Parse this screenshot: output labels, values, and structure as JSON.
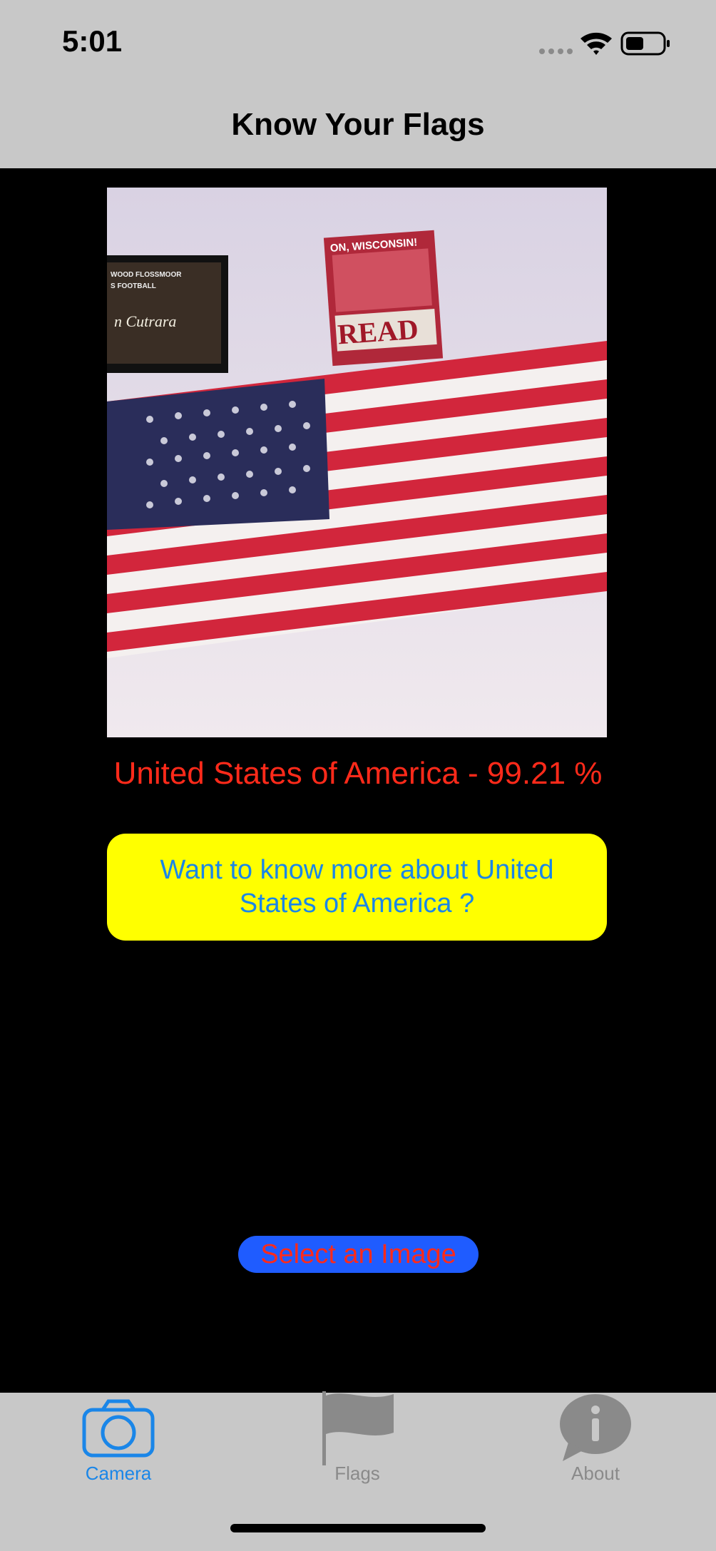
{
  "status_bar": {
    "time": "5:01",
    "icons": [
      "signal-icon",
      "wifi-icon",
      "battery-icon"
    ]
  },
  "nav": {
    "title": "Know Your Flags"
  },
  "main": {
    "photo_description_icon": "flag-photo",
    "photo_text": {
      "poster_top": "ON, WISCONSIN!",
      "poster_word": "READ",
      "frame_line1": "WOOD FLOSSMOOR",
      "frame_line2": "S FOOTBALL",
      "frame_script": "n Cutrara"
    },
    "result_text": "United States of America - 99.21 %",
    "more_button_label": "Want to know more about United States of America ?",
    "select_button_label": "Select an Image"
  },
  "tabs": [
    {
      "label": "Camera",
      "icon": "camera-icon",
      "active": true
    },
    {
      "label": "Flags",
      "icon": "flag-icon",
      "active": false
    },
    {
      "label": "About",
      "icon": "info-icon",
      "active": false
    }
  ],
  "colors": {
    "bar_bg": "#c8c8c8",
    "accent": "#1a86e8",
    "result": "#ff2a1a",
    "more_bg": "#ffff00",
    "select_bg": "#1f5cff",
    "inactive_tab": "#8a8a8a"
  }
}
